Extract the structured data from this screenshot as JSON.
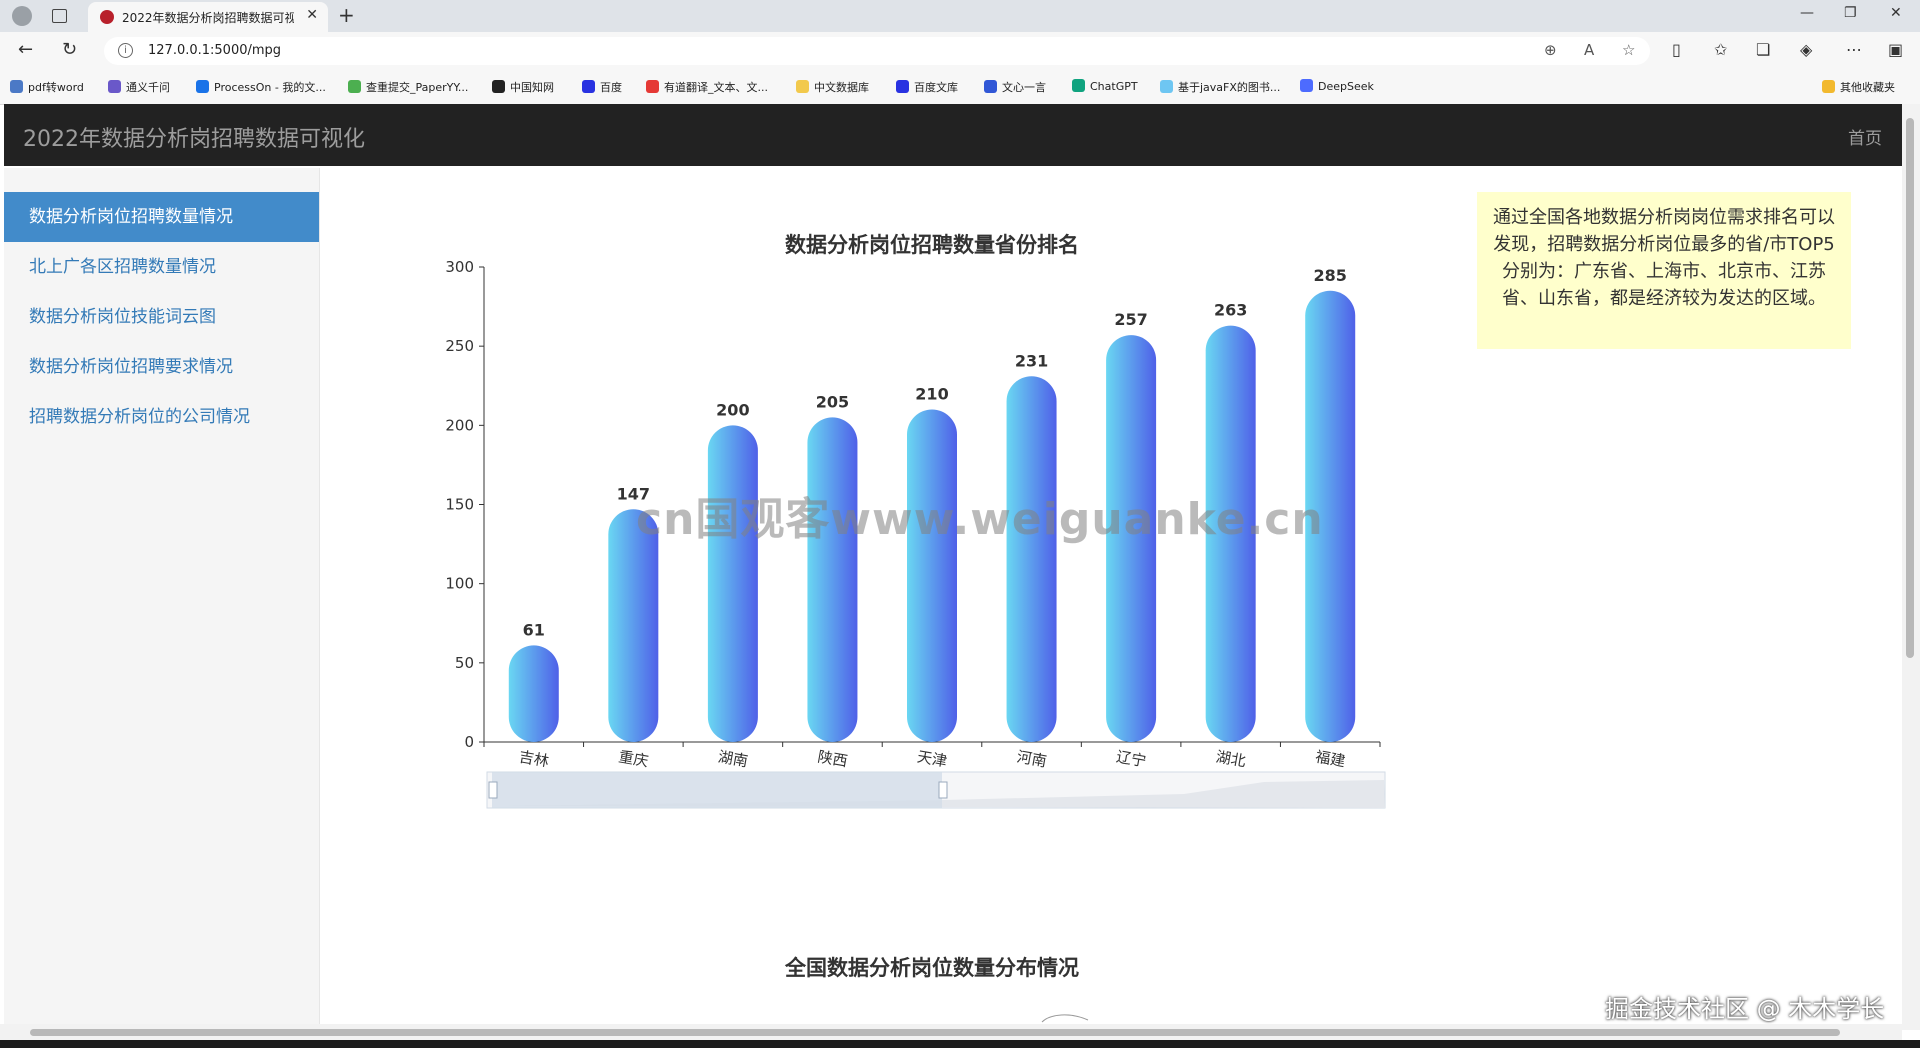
{
  "browser": {
    "tab_title": "2022年数据分析岗招聘数据可视化",
    "url": "127.0.0.1:5000/mpg",
    "bookmarks": [
      "pdf转word",
      "通义千问",
      "ProcessOn - 我的文...",
      "查重提交_PaperYY...",
      "中国知网",
      "百度",
      "有道翻译_文本、文...",
      "中文数据库",
      "百度文库",
      "文心一言",
      "ChatGPT",
      "基于javaFX的图书...",
      "DeepSeek"
    ],
    "other_bookmarks": "其他收藏夹"
  },
  "navbar": {
    "brand": "2022年数据分析岗招聘数据可视化",
    "home": "首页"
  },
  "sidebar": {
    "items": [
      {
        "label": "数据分析岗位招聘数量情况"
      },
      {
        "label": "北上广各区招聘数量情况"
      },
      {
        "label": "数据分析岗位技能词云图"
      },
      {
        "label": "数据分析岗位招聘要求情况"
      },
      {
        "label": "招聘数据分析岗位的公司情况"
      }
    ]
  },
  "note": "通过全国各地数据分析岗岗位需求排名可以发现，招聘数据分析岗位最多的省/市TOP5分别为：广东省、上海市、北京市、江苏省、山东省，都是经济较为发达的区域。",
  "chart_data": [
    {
      "type": "bar",
      "title": "数据分析岗位招聘数量省份排名",
      "categories": [
        "吉林",
        "重庆",
        "湖南",
        "陕西",
        "天津",
        "河南",
        "辽宁",
        "湖北",
        "福建"
      ],
      "values": [
        61,
        147,
        200,
        205,
        210,
        231,
        257,
        263,
        285
      ],
      "ylim": [
        0,
        300
      ],
      "yticks": [
        0,
        50,
        100,
        150,
        200,
        250,
        300
      ],
      "data_labels": true,
      "grid": false,
      "bar_colors": [
        "#6ad7f2",
        "#4f60e8"
      ]
    },
    {
      "type": "map",
      "title": "全国数据分析岗位数量分布情况"
    }
  ],
  "watermark": "cn国观客www.weiguanke.cn",
  "footer_watermark": "掘金技术社区 @ 木木学长"
}
